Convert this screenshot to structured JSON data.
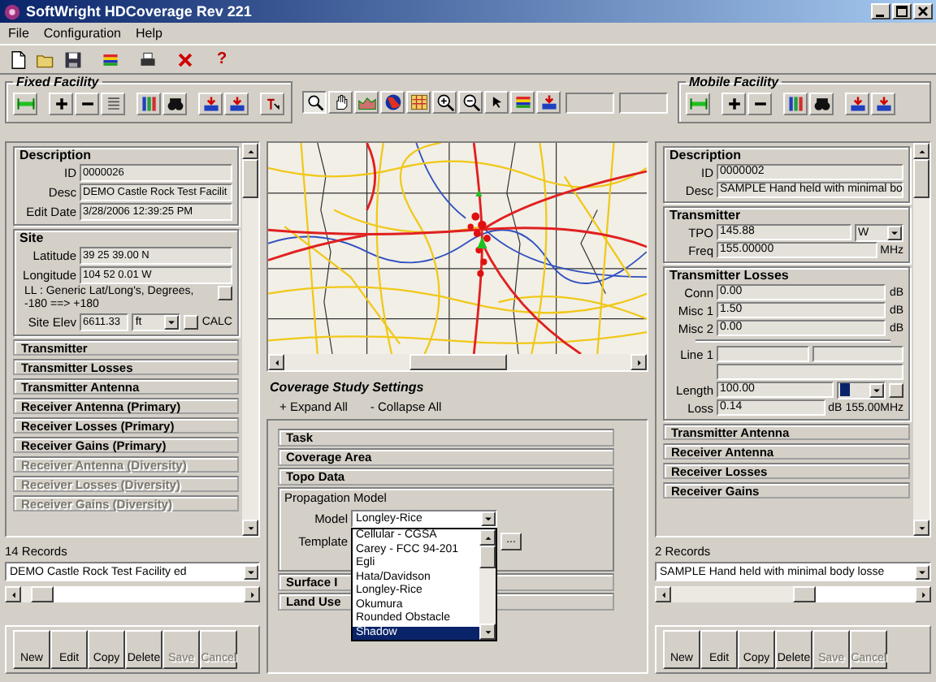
{
  "window": {
    "title": "SoftWright HDCoverage Rev 221"
  },
  "menu": [
    "File",
    "Configuration",
    "Help"
  ],
  "toolbar": {
    "help": "?"
  },
  "fixed_facility": {
    "title": "Fixed Facility",
    "sections": [
      {
        "title": "Description",
        "expanded": true,
        "fields": [
          {
            "kind": "field",
            "label": "ID",
            "value": "0000026"
          },
          {
            "kind": "field",
            "label": "Desc",
            "value": "DEMO Castle Rock Test Facilit"
          },
          {
            "kind": "field",
            "label": "Edit Date",
            "value": "3/28/2006 12:39:25 PM"
          }
        ]
      },
      {
        "title": "Site",
        "expanded": true,
        "fields": [
          {
            "kind": "field",
            "label": "Latitude",
            "value": "39 25 39.00 N"
          },
          {
            "kind": "field",
            "label": "Longitude",
            "value": "104 52 0.01 W"
          },
          {
            "kind": "note",
            "text": "LL : Generic Lat/Long's, Degrees, -180 ==> +180"
          },
          {
            "kind": "field",
            "label": "Site Elev",
            "value": "6611.33",
            "select": {
              "value": "ft",
              "focused": false
            },
            "button": true,
            "unit": "CALC"
          }
        ]
      },
      {
        "title": "Transmitter",
        "expanded": false,
        "disabled": false
      },
      {
        "title": "Transmitter Losses",
        "expanded": false,
        "disabled": false
      },
      {
        "title": "Transmitter Antenna",
        "expanded": false,
        "disabled": false
      },
      {
        "title": "Receiver Antenna (Primary)",
        "expanded": false,
        "disabled": false
      },
      {
        "title": "Receiver Losses (Primary)",
        "expanded": false,
        "disabled": false
      },
      {
        "title": "Receiver Gains (Primary)",
        "expanded": false,
        "disabled": false
      },
      {
        "title": "Receiver Antenna (Diversity)",
        "expanded": false,
        "disabled": true
      },
      {
        "title": "Receiver Losses (Diversity)",
        "expanded": false,
        "disabled": true
      },
      {
        "title": "Receiver Gains (Diversity)",
        "expanded": false,
        "disabled": true
      }
    ],
    "records": "14 Records",
    "selector": "DEMO Castle Rock Test Facility ed",
    "buttons": [
      {
        "label": "New",
        "disabled": false
      },
      {
        "label": "Edit",
        "disabled": false
      },
      {
        "label": "Copy",
        "disabled": false
      },
      {
        "label": "Delete",
        "disabled": false
      },
      {
        "label": "Save",
        "disabled": true
      },
      {
        "label": "Cancel",
        "disabled": true
      }
    ]
  },
  "coverage": {
    "title": "Coverage Study Settings",
    "expand": "+ Expand All",
    "collapse": "- Collapse All",
    "sections": [
      {
        "title": "Task",
        "expanded": false
      },
      {
        "title": "Coverage Area",
        "expanded": false
      },
      {
        "title": "Topo Data",
        "expanded": false
      },
      {
        "title": "Propagation Model",
        "expanded": true,
        "model_label": "Model",
        "model": "Longley-Rice",
        "template_label": "Template",
        "template_button": "...",
        "options": [
          {
            "label": "Cellular - CGSA",
            "selected": false
          },
          {
            "label": "Carey - FCC 94-201",
            "selected": false
          },
          {
            "label": "Egli",
            "selected": false
          },
          {
            "label": "Hata/Davidson",
            "selected": false
          },
          {
            "label": "Longley-Rice",
            "selected": false
          },
          {
            "label": "Okumura",
            "selected": false
          },
          {
            "label": "Rounded Obstacle",
            "selected": false
          },
          {
            "label": "Shadow",
            "selected": true
          }
        ]
      },
      {
        "title": "Surface I",
        "expanded": false
      },
      {
        "title": "Land Use",
        "expanded": false
      }
    ]
  },
  "mobile_facility": {
    "title": "Mobile Facility",
    "sections": [
      {
        "title": "Description",
        "expanded": true,
        "fields": [
          {
            "kind": "field",
            "label": "ID",
            "value": "0000002"
          },
          {
            "kind": "field",
            "label": "Desc",
            "value": "SAMPLE Hand held with minimal bo"
          }
        ]
      },
      {
        "title": "Transmitter",
        "expanded": true,
        "fields": [
          {
            "kind": "field",
            "label": "TPO",
            "value": "145.88",
            "select": {
              "value": "W",
              "focused": false
            }
          },
          {
            "kind": "field",
            "label": "Freq",
            "value": "155.00000",
            "unit": "MHz"
          }
        ]
      },
      {
        "title": "Transmitter Losses",
        "expanded": true,
        "fields": [
          {
            "kind": "field",
            "label": "Conn",
            "value": "0.00",
            "unit": "dB"
          },
          {
            "kind": "field",
            "label": "Misc 1",
            "value": "1.50",
            "unit": "dB"
          },
          {
            "kind": "field",
            "label": "Misc 2",
            "value": "0.00",
            "unit": "dB"
          },
          {
            "kind": "rule"
          },
          {
            "kind": "line",
            "label": "Line 1"
          },
          {
            "kind": "field",
            "label": "Length",
            "value": "100.00",
            "select": {
              "focused": true
            },
            "button": true
          },
          {
            "kind": "field",
            "label": "Loss",
            "value": "0.14",
            "unit": "dB",
            "extra": "155.00MHz"
          }
        ]
      },
      {
        "title": "Transmitter Antenna",
        "expanded": false,
        "disabled": false
      },
      {
        "title": "Receiver Antenna",
        "expanded": false,
        "disabled": false
      },
      {
        "title": "Receiver Losses",
        "expanded": false,
        "disabled": false
      },
      {
        "title": "Receiver Gains",
        "expanded": false,
        "disabled": false
      }
    ],
    "records": "2 Records",
    "selector": "SAMPLE Hand held with minimal body losse",
    "buttons": [
      {
        "label": "New",
        "disabled": false
      },
      {
        "label": "Edit",
        "disabled": false
      },
      {
        "label": "Copy",
        "disabled": false
      },
      {
        "label": "Delete",
        "disabled": false
      },
      {
        "label": "Save",
        "disabled": true
      },
      {
        "label": "Cancel",
        "disabled": true
      }
    ]
  }
}
